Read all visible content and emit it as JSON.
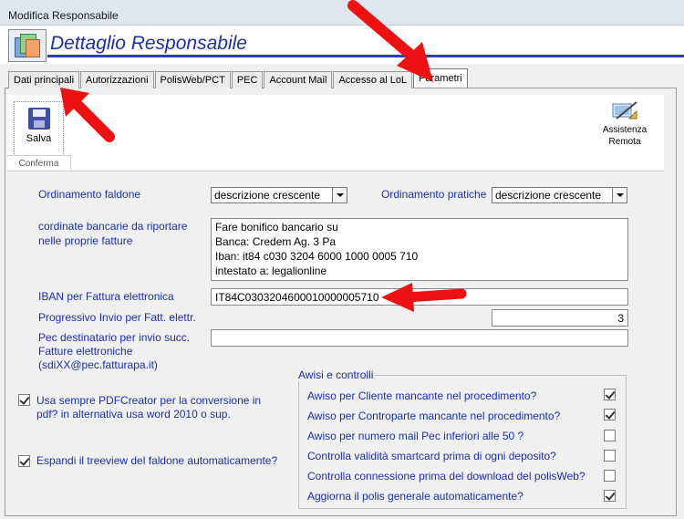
{
  "window": {
    "title": "Modifica Responsabile"
  },
  "header": {
    "title": "Dettaglio Responsabile",
    "icon": "address-book-icon"
  },
  "tabs": [
    {
      "label": "Dati principali",
      "active": false
    },
    {
      "label": "Autorizzazioni",
      "active": false
    },
    {
      "label": "PolisWeb/PCT",
      "active": false
    },
    {
      "label": "PEC",
      "active": false
    },
    {
      "label": "Account Mail",
      "active": false
    },
    {
      "label": "Accesso al LoL",
      "active": false
    },
    {
      "label": "Parametri",
      "active": true
    }
  ],
  "toolbar": {
    "save_label": "Salva",
    "save_icon": "floppy-disk-icon",
    "group_label": "Conferma",
    "remote_label_line1": "Assistenza",
    "remote_label_line2": "Remota",
    "remote_icon": "remote-assistance-icon"
  },
  "form": {
    "ordinamento_faldone_label": "Ordinamento faldone",
    "ordinamento_faldone_value": "descrizione crescente",
    "ordinamento_pratiche_label": "Ordinamento pratiche",
    "ordinamento_pratiche_value": "descrizione crescente",
    "coordinate_label_line1": "cordinate bancarie da riportare",
    "coordinate_label_line2": "nelle proprie fatture",
    "coordinate_value": "Fare bonifico bancario su\nBanca: Credem Ag. 3 Pa\nIban: it84 c030 3204 6000 1000 0005 710\nintestato a: legalionline",
    "iban_label": "IBAN per Fattura elettronica",
    "iban_value": "IT84C0303204600010000005710",
    "progressivo_label": "Progressivo Invio per Fatt. elettr.",
    "progressivo_value": "3",
    "pec_label_line1": "Pec destinatario per invio succ.",
    "pec_label_line2": "Fatture elettroniche",
    "pec_label_line3": "(sdiXX@pec.fatturapa.it)",
    "pec_value": ""
  },
  "options": {
    "pdfcreator_label_line1": "Usa sempre PDFCreator per la conversione in",
    "pdfcreator_label_line2": "pdf? in alternativa usa word 2010 o sup.",
    "pdfcreator_checked": true,
    "treeview_label": "Espandi il treeview del faldone automaticamente?",
    "treeview_checked": true
  },
  "avvisi": {
    "title": "Awisi e controlli",
    "items": [
      {
        "label": "Awiso per Cliente mancante nel procedimento?",
        "checked": true
      },
      {
        "label": "Awiso per Controparte mancante nel procedimento?",
        "checked": true
      },
      {
        "label": "Awiso per numero mail Pec inferiori alle 50 ?",
        "checked": false
      },
      {
        "label": "Controlla validità smartcard prima di ogni deposito?",
        "checked": false
      },
      {
        "label": "Controlla connessione prima del download del polisWeb?",
        "checked": false
      },
      {
        "label": "Aggiorna il polis generale automaticamente?",
        "checked": true
      }
    ]
  },
  "annotations": {
    "arrow_color": "#ee1111"
  }
}
